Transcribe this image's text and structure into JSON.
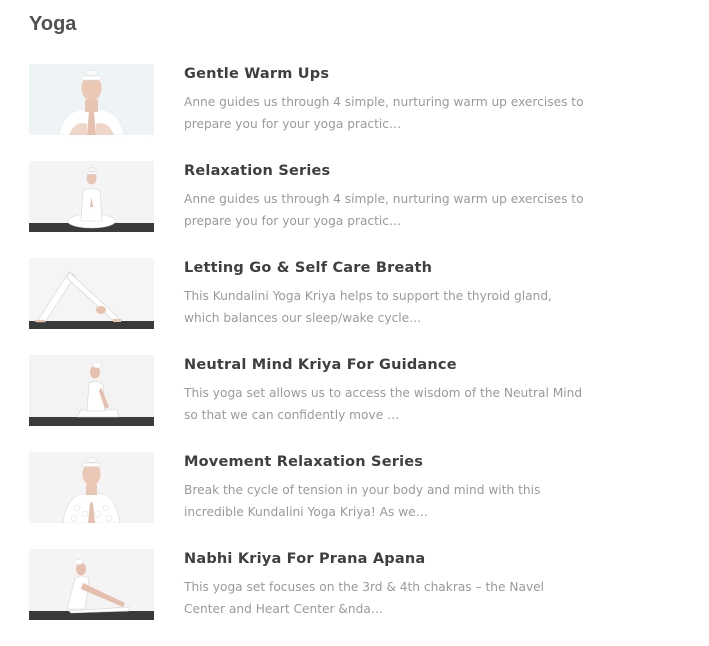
{
  "page": {
    "title": "Yoga"
  },
  "videos": [
    {
      "title": "Gentle Warm Ups",
      "description": "Anne guides us through 4 simple, nurturing warm up exercises to prepare you for your yoga practic…",
      "thumbnail": "instructor-prayer-hands-closeup"
    },
    {
      "title": "Relaxation Series",
      "description": "Anne guides us through 4 simple, nurturing warm up exercises to prepare you for your yoga practic…",
      "thumbnail": "instructor-seated-meditation"
    },
    {
      "title": "Letting Go & Self Care Breath",
      "description": "This Kundalini Yoga Kriya helps to support the thyroid gland, which balances our sleep/wake cycle…",
      "thumbnail": "instructor-downward-dog"
    },
    {
      "title": "Neutral Mind Kriya For Guidance",
      "description": "This yoga set allows us to access the wisdom of the Neutral Mind so that we can confidently move …",
      "thumbnail": "instructor-kneeling-side-view"
    },
    {
      "title": "Movement Relaxation Series",
      "description": "Break the cycle of tension in your body and mind with this incredible Kundalini Yoga Kriya! As we…",
      "thumbnail": "instructor-lace-top-prayer"
    },
    {
      "title": "Nabhi Kriya For Prana Apana",
      "description": "This yoga set focuses on the 3rd & 4th chakras – the Navel Center and Heart Center &nda…",
      "thumbnail": "instructor-seated-forward-bend"
    }
  ],
  "colors": {
    "title": "#3f3f3f",
    "description": "#9a9a9a",
    "heading": "#505050",
    "mat": "#3b3b3b",
    "skin": "#e9c6b4",
    "white": "#ffffff"
  }
}
